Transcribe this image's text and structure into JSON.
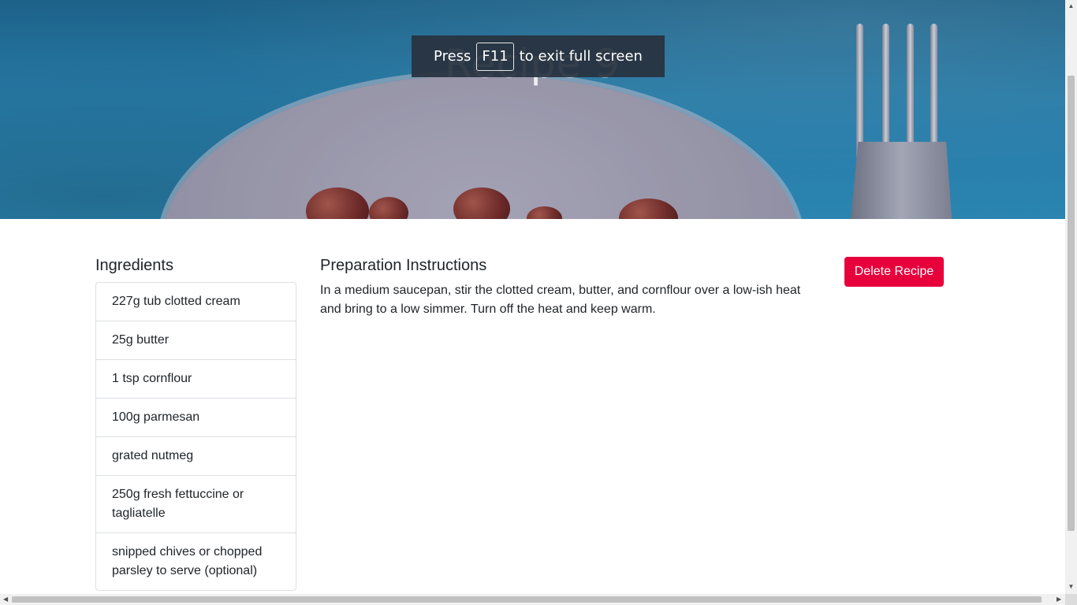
{
  "hero": {
    "title": "Recipe 9"
  },
  "fullscreen_toast": {
    "press": "Press",
    "key": "F11",
    "suffix": "to exit full screen"
  },
  "ingredients": {
    "heading": "Ingredients",
    "items": [
      "227g tub clotted cream",
      "25g butter",
      "1 tsp cornflour",
      "100g parmesan",
      "grated nutmeg",
      "250g fresh fettuccine or tagliatelle",
      "snipped chives or chopped parsley to serve (optional)"
    ]
  },
  "instructions": {
    "heading": "Preparation Instructions",
    "text": "In a medium saucepan, stir the clotted cream, butter, and cornflour over a low-ish heat and bring to a low simmer. Turn off the heat and keep warm."
  },
  "actions": {
    "delete_label": "Delete Recipe"
  },
  "colors": {
    "delete_button": "#e8003d",
    "hero_blue": "#2a86b6"
  }
}
